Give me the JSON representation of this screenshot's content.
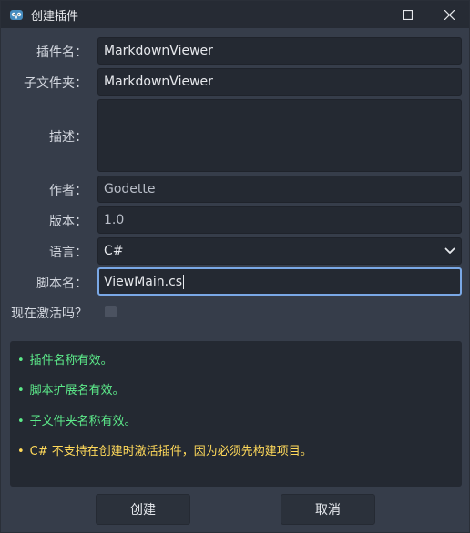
{
  "window": {
    "title": "创建插件",
    "app_icon": "godot-icon",
    "controls": [
      "minimize-icon",
      "maximize-icon",
      "close-icon"
    ]
  },
  "form": {
    "plugin_name": {
      "label": "插件名：",
      "value": "MarkdownViewer"
    },
    "subfolder": {
      "label": "子文件夹：",
      "value": "MarkdownViewer"
    },
    "description": {
      "label": "描述：",
      "value": ""
    },
    "author": {
      "label": "作者：",
      "value": "Godette"
    },
    "version": {
      "label": "版本：",
      "value": "1.0"
    },
    "language": {
      "label": "语言：",
      "selected": "C#"
    },
    "script_name": {
      "label": "脚本名：",
      "value": "ViewMain.cs"
    },
    "activate_now": {
      "label": "现在激活吗？",
      "checked": false
    }
  },
  "messages": [
    {
      "bullet": "•",
      "text": "插件名称有效。",
      "status": "ok"
    },
    {
      "bullet": "•",
      "text": "脚本扩展名有效。",
      "status": "ok"
    },
    {
      "bullet": "•",
      "text": "子文件夹名称有效。",
      "status": "ok"
    },
    {
      "bullet": "•",
      "text": "C# 不支持在创建时激活插件，因为必须先构建项目。",
      "status": "warn"
    }
  ],
  "buttons": {
    "create": "创建",
    "cancel": "取消"
  },
  "colors": {
    "background": "#363d4a",
    "field": "#242932",
    "ok": "#5cea8a",
    "warn": "#ffd95a",
    "focus": "#7aa8e6"
  }
}
